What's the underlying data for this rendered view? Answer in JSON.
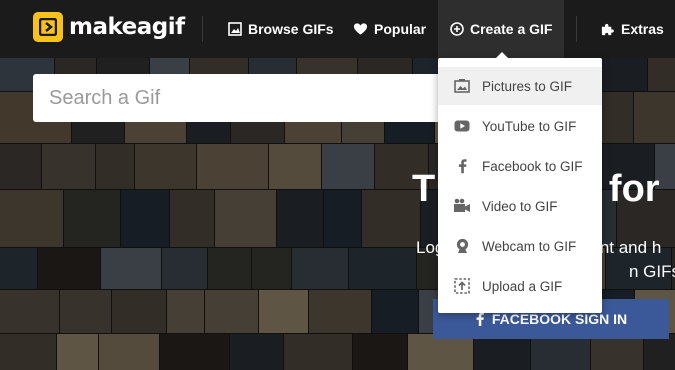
{
  "brand": {
    "name": "makeagif",
    "accent": "#f7c21c"
  },
  "nav": {
    "browse_label": "Browse GIFs",
    "popular_label": "Popular",
    "create_label": "Create a GIF",
    "extras_label": "Extras"
  },
  "search": {
    "placeholder": "Search a Gif"
  },
  "hero": {
    "title": "T",
    "title_tail": "e for",
    "subtitle_line1_start": "Log",
    "subtitle_line1_end": "unt and h",
    "subtitle_line2_end": "n GIFs an",
    "cta_label": "FACEBOOK SIGN IN"
  },
  "dropdown": {
    "items": [
      {
        "label": "Pictures to GIF",
        "icon": "pictures-icon"
      },
      {
        "label": "YouTube to GIF",
        "icon": "youtube-icon"
      },
      {
        "label": "Facebook to GIF",
        "icon": "facebook-icon"
      },
      {
        "label": "Video to GIF",
        "icon": "video-camera-icon"
      },
      {
        "label": "Webcam to GIF",
        "icon": "webcam-icon"
      },
      {
        "label": "Upload a GIF",
        "icon": "upload-icon"
      }
    ]
  },
  "colors": {
    "facebook": "#3b5998",
    "topbar": "#1b1b1b",
    "dropdown_hover": "#f0f0f0"
  }
}
